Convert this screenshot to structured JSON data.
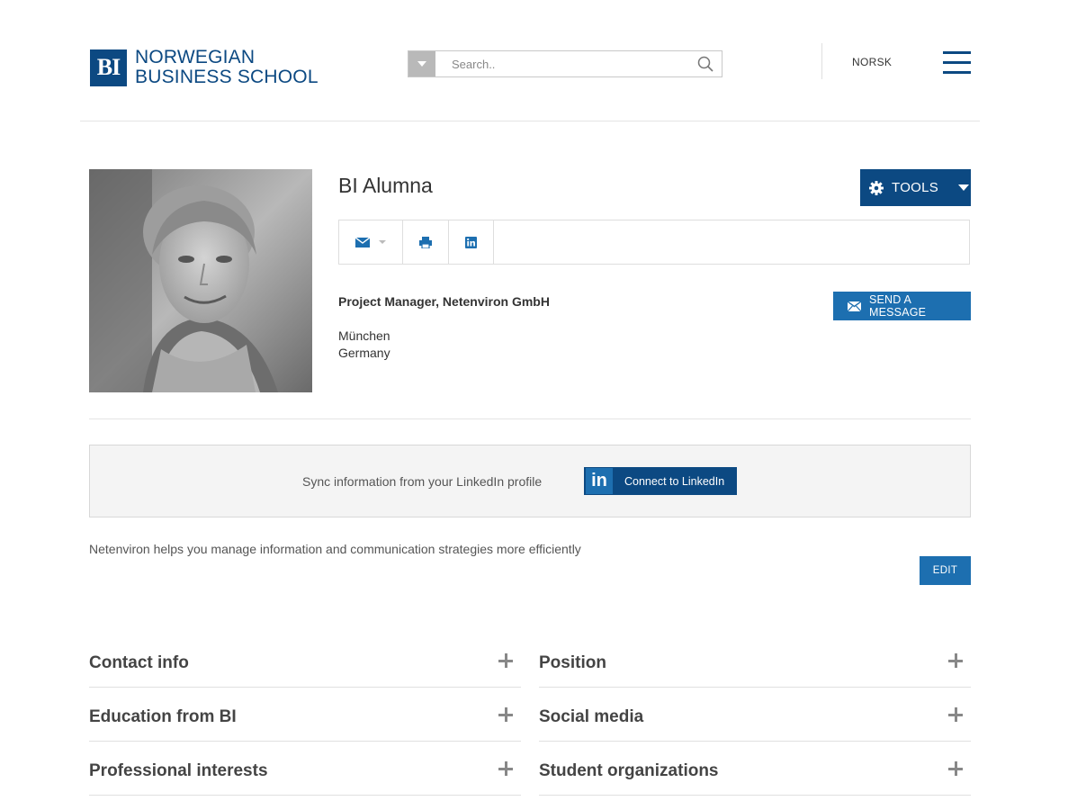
{
  "header": {
    "logo_mark": "BI",
    "logo_line1": "NORWEGIAN",
    "logo_line2": "BUSINESS SCHOOL",
    "search_placeholder": "Search..",
    "language": "NORSK"
  },
  "profile": {
    "name": "BI Alumna",
    "tools_label": "TOOLS",
    "job_title": "Project Manager, Netenviron GmbH",
    "city": "München",
    "country": "Germany",
    "send_message_label": "SEND A MESSAGE"
  },
  "linkedin_sync": {
    "text": "Sync information from your LinkedIn profile",
    "badge": "in",
    "button_label": "Connect to LinkedIn"
  },
  "about": {
    "text": "Netenviron helps you manage information and communication strategies more efficiently",
    "edit_label": "EDIT"
  },
  "sections": {
    "left": [
      "Contact info",
      "Education from BI",
      "Professional interests"
    ],
    "right": [
      "Position",
      "Social media",
      "Student organizations"
    ]
  },
  "colors": {
    "brand_dark": "#0c4982",
    "brand_light": "#1d6fb0"
  }
}
